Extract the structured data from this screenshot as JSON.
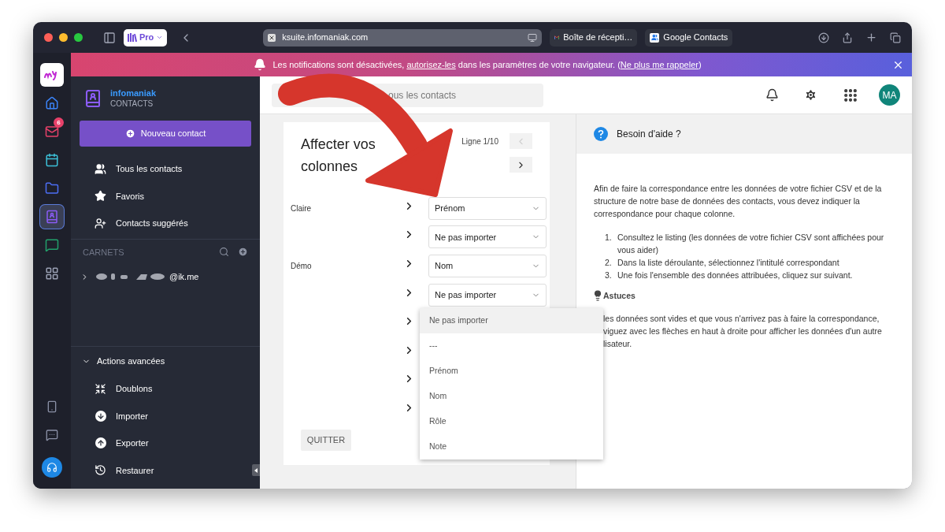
{
  "browser": {
    "profile": "Pro",
    "address": "ksuite.infomaniak.com",
    "tabs": [
      {
        "label": "Boîte de récepti…",
        "kind": "mail",
        "selected": false
      },
      {
        "label": "Google Contacts",
        "kind": "contacts",
        "selected": false
      }
    ]
  },
  "banner": {
    "before": "Les notifications sont désactivées, ",
    "link": "autorisez-les",
    "middle": " dans les paramètres de votre navigateur. (",
    "link2": "Ne plus me rappeler",
    "after": ")"
  },
  "rail": {
    "items": [
      {
        "kind": "my",
        "selected": false
      },
      {
        "kind": "home",
        "selected": false
      },
      {
        "kind": "mail",
        "selected": false,
        "badge": "6"
      },
      {
        "kind": "calendar",
        "selected": false
      },
      {
        "kind": "drive",
        "selected": false
      },
      {
        "kind": "contacts",
        "selected": true
      },
      {
        "kind": "chat",
        "selected": false
      },
      {
        "kind": "apps",
        "selected": false
      }
    ],
    "bottom": [
      {
        "kind": "device"
      },
      {
        "kind": "feedback"
      },
      {
        "kind": "support"
      }
    ]
  },
  "sidebar": {
    "brand": "infomaniak",
    "product": "CONTACTS",
    "new_button": "Nouveau contact",
    "nav": [
      {
        "label": "Tous les contacts",
        "kind": "users"
      },
      {
        "label": "Favoris",
        "kind": "star"
      },
      {
        "label": "Contacts suggérés",
        "kind": "suggest"
      }
    ],
    "books_heading": "CARNETS",
    "books": [
      {
        "label": "@ik.me",
        "expanded": false
      }
    ],
    "advanced": {
      "label": "Actions avancées",
      "expanded": true,
      "items": [
        {
          "label": "Doublons",
          "kind": "merge"
        },
        {
          "label": "Importer",
          "kind": "import"
        },
        {
          "label": "Exporter",
          "kind": "export"
        },
        {
          "label": "Restaurer",
          "kind": "restore"
        }
      ]
    }
  },
  "header": {
    "search_placeholder": "ous les contacts",
    "avatar": "MA"
  },
  "mapping": {
    "title": "Affecter vos colonnes",
    "counter": "Ligne 1/10",
    "prev_disabled": true,
    "next_disabled": false,
    "rows": [
      {
        "label": "Claire",
        "value": "Prénom"
      },
      {
        "value": "Ne pas importer"
      },
      {
        "label": "Démo",
        "value": "Nom"
      },
      {
        "value": "Ne pas importer"
      },
      {},
      {},
      {},
      {}
    ],
    "dropdown": [
      {
        "label": "Ne pas importer",
        "selected": true
      },
      {
        "label": "---",
        "selected": false
      },
      {
        "label": "Prénom",
        "selected": false
      },
      {
        "label": "Nom",
        "selected": false
      },
      {
        "label": "Rôle",
        "selected": false
      },
      {
        "label": "Note",
        "selected": false
      }
    ],
    "quit": "QUITTER"
  },
  "help": {
    "title": "Besoin d'aide ?",
    "intro": "Afin de faire la correspondance entre les données de votre fichier CSV et de la structure de notre base de données des contacts, vous devez indiquer la correspondance pour chaque colonne.",
    "steps": [
      {
        "number": "1.",
        "text": "Consultez le listing (les données de votre fichier CSV sont affichées pour vous aider)"
      },
      {
        "number": "2.",
        "text": "Dans la liste déroulante, sélectionnez l'intitulé correspondant"
      },
      {
        "number": "3.",
        "text": "Une fois l'ensemble des données attribuées, cliquez sur suivant."
      }
    ],
    "tips_title": "Astuces",
    "tip_lines": [
      "les données sont vides et que vous n'arrivez pas à faire la correspondance,",
      "viguez avec les flèches en haut à droite pour afficher les données d'un autre",
      "lisateur."
    ]
  }
}
